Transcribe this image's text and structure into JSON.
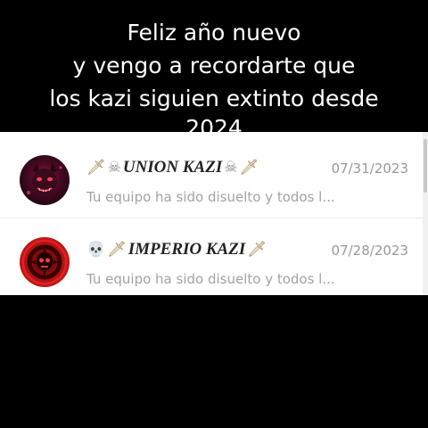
{
  "caption": {
    "line1": "Feliz año nuevo",
    "line2": "y vengo a recordarte que",
    "line3": "los kazi siguien extinto desde",
    "line4": "2024"
  },
  "chats": [
    {
      "name": "UNION KAZI",
      "name_prefix_icons": [
        "dagger-icon",
        "skull-crossbones-icon"
      ],
      "name_suffix_icons": [
        "skull-crossbones-icon",
        "dagger-icon"
      ],
      "date": "07/31/2023",
      "preview": "Tu equipo ha sido disuelto y todos l...",
      "avatar": "avatar-demon-icon"
    },
    {
      "name": "IMPERIO KAZI",
      "name_prefix_icons": [
        "skull-icon",
        "dagger-icon"
      ],
      "name_suffix_icons": [
        "dagger-icon"
      ],
      "date": "07/28/2023",
      "preview": "Tu equipo ha sido disuelto y todos l...",
      "avatar": "avatar-skull-icon"
    }
  ],
  "colors": {
    "background": "#000000",
    "panel": "#ffffff",
    "caption_text": "#ffffff",
    "name_text": "#222222",
    "meta_text": "#999999"
  }
}
